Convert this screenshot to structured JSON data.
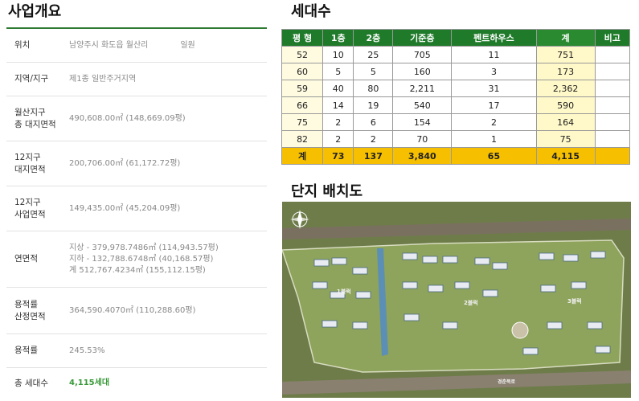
{
  "titles": {
    "overview": "사업개요",
    "units": "세대수",
    "site_plan": "단지 배치도"
  },
  "overview": [
    {
      "label": "위치",
      "value": "남양주시 화도읍 월산리",
      "extra": "일원"
    },
    {
      "label": "지역/지구",
      "value": "제1종 일반주거지역"
    },
    {
      "label": "월산지구\n총 대지면적",
      "value": "490,608.00㎡ (148,669.09평)"
    },
    {
      "label": "12지구\n대지면적",
      "value": "200,706.00㎡ (61,172.72평)"
    },
    {
      "label": "12지구\n사업면적",
      "value": "149,435.00㎡ (45,204.09평)"
    },
    {
      "label": "연면적",
      "value": "지상 - 379,978.7486㎡ (114,943.57평)\n지하 - 132,788.6748㎡ (40,168.57평)\n계 512,767.4234㎡ (155,112.15평)"
    },
    {
      "label": "용적률\n산정면적",
      "value": "364,590.4070㎡ (110,288.60평)"
    },
    {
      "label": "용적률",
      "value": "245.53%"
    },
    {
      "label": "총 세대수",
      "value": "4,115세대"
    }
  ],
  "units_table": {
    "headers": [
      "평 형",
      "1층",
      "2층",
      "기준층",
      "펜트하우스",
      "계",
      "비고"
    ],
    "rows": [
      [
        "52",
        "10",
        "25",
        "705",
        "11",
        "751",
        ""
      ],
      [
        "60",
        "5",
        "5",
        "160",
        "3",
        "173",
        ""
      ],
      [
        "59",
        "40",
        "80",
        "2,211",
        "31",
        "2,362",
        ""
      ],
      [
        "66",
        "14",
        "19",
        "540",
        "17",
        "590",
        ""
      ],
      [
        "75",
        "2",
        "6",
        "154",
        "2",
        "164",
        ""
      ],
      [
        "82",
        "2",
        "2",
        "70",
        "1",
        "75",
        ""
      ]
    ],
    "total": [
      "계",
      "73",
      "137",
      "3,840",
      "65",
      "4,115",
      ""
    ]
  },
  "map_labels": {
    "block1": "1블럭",
    "block2": "2블럭",
    "block3": "3블럭",
    "road": "경춘북로",
    "buildings": [
      "101동",
      "102동",
      "103동",
      "104동",
      "105동",
      "106동",
      "107동",
      "108동",
      "201동",
      "202동",
      "203동",
      "204동",
      "205동",
      "206동",
      "207동",
      "208동",
      "209동",
      "210동",
      "301동",
      "302동",
      "303동",
      "304동",
      "305동",
      "306동"
    ]
  },
  "colors": {
    "header_green": "#1f7a2a",
    "total_yellow": "#f6c000",
    "accent_green": "#3a9a3a"
  }
}
